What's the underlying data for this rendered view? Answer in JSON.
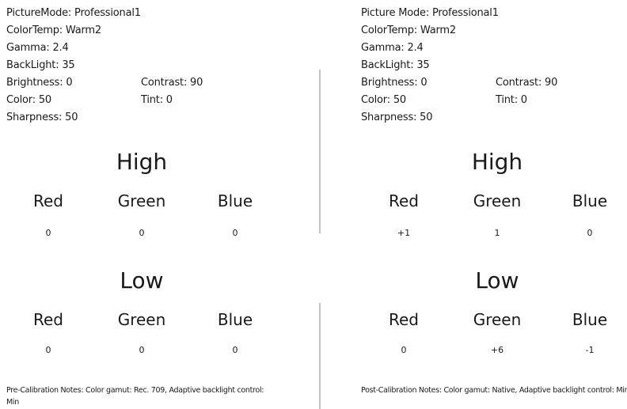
{
  "pre": {
    "settings": {
      "picture_mode": "PictureMode: Professional1",
      "color_temp": "ColorTemp: Warm2",
      "gamma": "Gamma: 2.4",
      "backlight": "BackLight: 35",
      "brightness": "Brightness: 0",
      "contrast": "Contrast: 90",
      "color": "Color: 50",
      "tint": "Tint: 0",
      "sharpness": "Sharpness: 50"
    },
    "high": {
      "title": "High",
      "channels": [
        {
          "label": "Red",
          "value": "0"
        },
        {
          "label": "Green",
          "value": "0"
        },
        {
          "label": "Blue",
          "value": "0"
        }
      ]
    },
    "low": {
      "title": "Low",
      "channels": [
        {
          "label": "Red",
          "value": "0"
        },
        {
          "label": "Green",
          "value": "0"
        },
        {
          "label": "Blue",
          "value": "0"
        }
      ]
    },
    "notes": "Pre-Calibration Notes: Color gamut: Rec. 709, Adaptive backlight control: Min"
  },
  "post": {
    "settings": {
      "picture_mode": "Picture Mode: Professional1",
      "color_temp": "ColorTemp: Warm2",
      "gamma": "Gamma: 2.4",
      "backlight": "BackLight: 35",
      "brightness": "Brightness: 0",
      "contrast": "Contrast: 90",
      "color": "Color: 50",
      "tint": "Tint: 0",
      "sharpness": "Sharpness: 50"
    },
    "high": {
      "title": "High",
      "channels": [
        {
          "label": "Red",
          "value": "+1"
        },
        {
          "label": "Green",
          "value": "1"
        },
        {
          "label": "Blue",
          "value": "0"
        }
      ]
    },
    "low": {
      "title": "Low",
      "channels": [
        {
          "label": "Red",
          "value": "0"
        },
        {
          "label": "Green",
          "value": "+6"
        },
        {
          "label": "Blue",
          "value": "-1"
        }
      ]
    },
    "notes": "Post-Calibration Notes: Color gamut: Native, Adaptive backlight control: Min"
  }
}
